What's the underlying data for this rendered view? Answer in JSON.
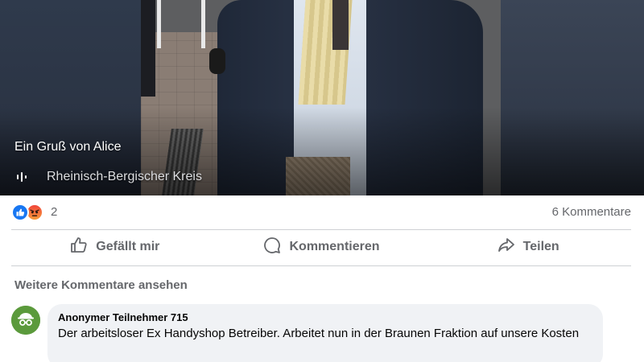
{
  "video": {
    "caption": "Ein Gruß von Alice",
    "location": "Rheinisch-Bergischer Kreis",
    "audio_icon": "audio-waveform-icon"
  },
  "reactions": {
    "icons": [
      "like-icon",
      "angry-icon"
    ],
    "count": "2",
    "comments_count": "6 Kommentare"
  },
  "actions": {
    "like_label": "Gefällt mir",
    "comment_label": "Kommentieren",
    "share_label": "Teilen"
  },
  "comments": {
    "more_label": "Weitere Kommentare ansehen",
    "items": [
      {
        "author": "Anonymer Teilnehmer 715",
        "text": "Der arbeitsloser Ex Handyshop Betreiber. Arbeitet nun in der Braunen Fraktion auf unsere Kosten",
        "avatar_icon": "anonymous-user-icon"
      }
    ]
  },
  "colors": {
    "brand_blue": "#1877f2",
    "secondary_text": "#65676b",
    "comment_bubble": "#f0f2f5"
  }
}
